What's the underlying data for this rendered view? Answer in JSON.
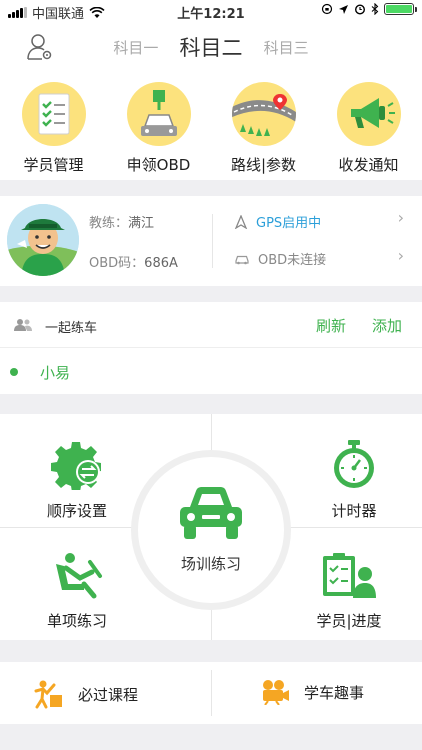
{
  "status_bar": {
    "carrier": "中国联通",
    "time": "上午12:21"
  },
  "header": {
    "tabs": [
      {
        "label": "科目一",
        "active": false
      },
      {
        "label": "科目二",
        "active": true
      },
      {
        "label": "科目三",
        "active": false
      }
    ]
  },
  "quick_nav": [
    {
      "label": "学员管理",
      "icon": "clipboard-checklist-icon"
    },
    {
      "label": "申领OBD",
      "icon": "obd-device-icon"
    },
    {
      "label": "路线|参数",
      "icon": "route-map-icon"
    },
    {
      "label": "收发通知",
      "icon": "megaphone-icon"
    }
  ],
  "coach": {
    "coach_label": "教练：",
    "coach_name": "满江",
    "obd_label": "OBD码：",
    "obd_code": "686A",
    "gps_status": "GPS启用中",
    "obd_status": "OBD未连接"
  },
  "together": {
    "title": "一起练车",
    "refresh_label": "刷新",
    "add_label": "添加",
    "members": [
      "小易"
    ]
  },
  "grid": {
    "sequence_settings": "顺序设置",
    "timer": "计时器",
    "field_practice": "场训练习",
    "single_practice": "单项练习",
    "student_progress": "学员|进度"
  },
  "bottom": {
    "required_course": "必过课程",
    "fun_stories": "学车趣事"
  },
  "colors": {
    "accent_green": "#3fb24f",
    "gps_blue": "#2c9fd9",
    "icon_yellow": "#fce27d",
    "icon_orange": "#f5a623"
  }
}
